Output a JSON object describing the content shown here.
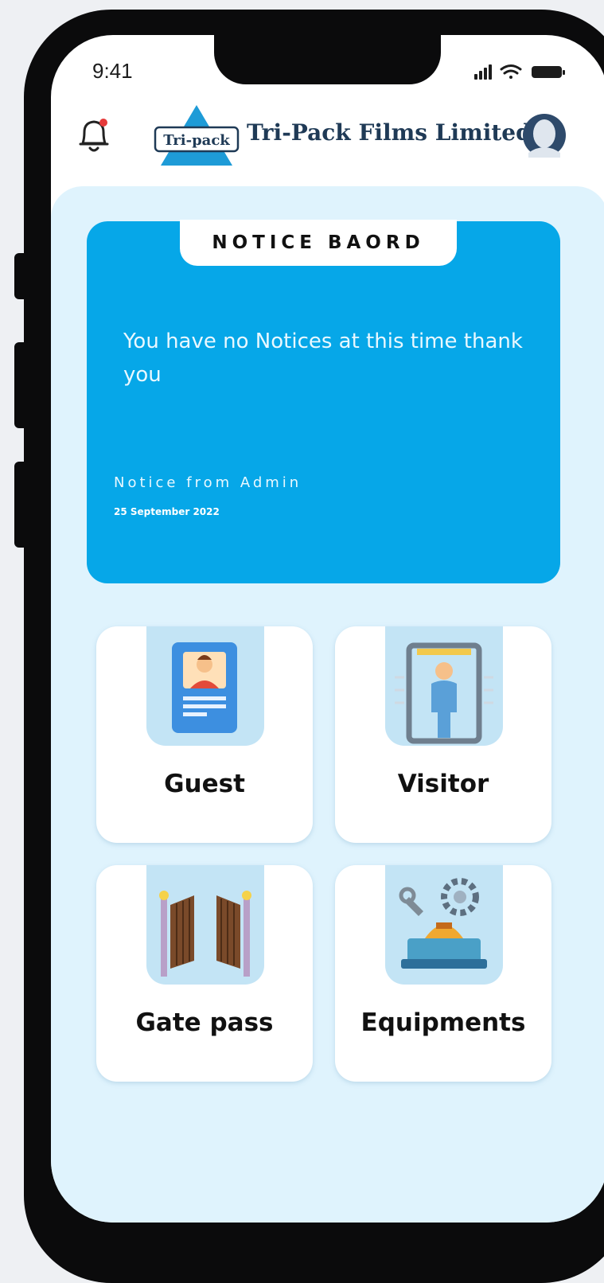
{
  "status_bar": {
    "time": "9:41"
  },
  "header": {
    "logo_mark_text": "Tri-pack",
    "company_name": "Tri-Pack Films Limited",
    "brand_color": "#1f3a56",
    "logo_accent": "#1e9bd7"
  },
  "notice_board": {
    "title": "NOTICE BAORD",
    "message": "You have no Notices at this time thank you",
    "from": "Notice from Admin",
    "date": "25 September 2022",
    "background": "#06a7e8"
  },
  "tiles": [
    {
      "label": "Guest",
      "icon": "id-card-icon"
    },
    {
      "label": "Visitor",
      "icon": "security-gate-icon"
    },
    {
      "label": "Gate pass",
      "icon": "gate-icon"
    },
    {
      "label": "Equipments",
      "icon": "equipment-icon"
    }
  ],
  "colors": {
    "content_bg": "#dff3fd",
    "tile_art_bg": "#c3e4f5"
  }
}
